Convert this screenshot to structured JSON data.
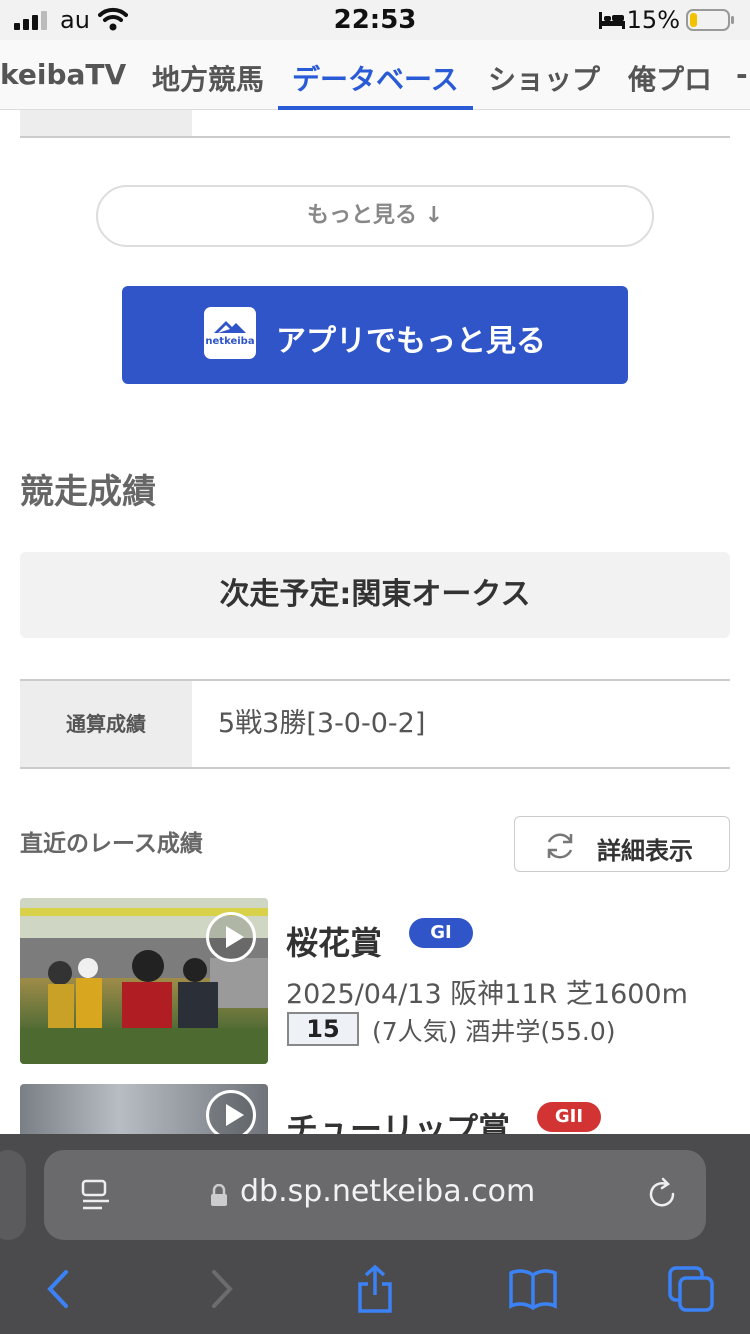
{
  "status_bar": {
    "carrier": "au",
    "time": "22:53",
    "battery_percent": "15%"
  },
  "tabs": [
    {
      "label": "keibaTV",
      "active": false
    },
    {
      "label": "地方競馬",
      "active": false
    },
    {
      "label": "データベース",
      "active": true
    },
    {
      "label": "ショップ",
      "active": false
    },
    {
      "label": "俺プロ",
      "active": false
    }
  ],
  "more_button": {
    "label": "もっと見る ↓"
  },
  "app_button": {
    "label": "アプリでもっと見る",
    "logo_text": "netkeiba"
  },
  "race_results": {
    "title": "競走成績",
    "next_race": "次走予定:関東オークス",
    "record_label": "通算成績",
    "record_value": "5戦3勝[3-0-0-2]",
    "recent_title": "直近のレース成績",
    "detail_button": "詳細表示"
  },
  "races": [
    {
      "name": "桜花賞",
      "grade": "GI",
      "meta": "2025/04/13 阪神11R 芝1600m",
      "horse_number": "15",
      "result": "(7人気) 酒井学(55.0)"
    },
    {
      "name": "チューリップ賞",
      "grade": "GII"
    }
  ],
  "browser": {
    "url": "db.sp.netkeiba.com"
  },
  "colors": {
    "accent": "#2a5bd7",
    "app_button": "#2f55c8",
    "grade1": "#2f55c8",
    "grade2": "#d23434"
  }
}
